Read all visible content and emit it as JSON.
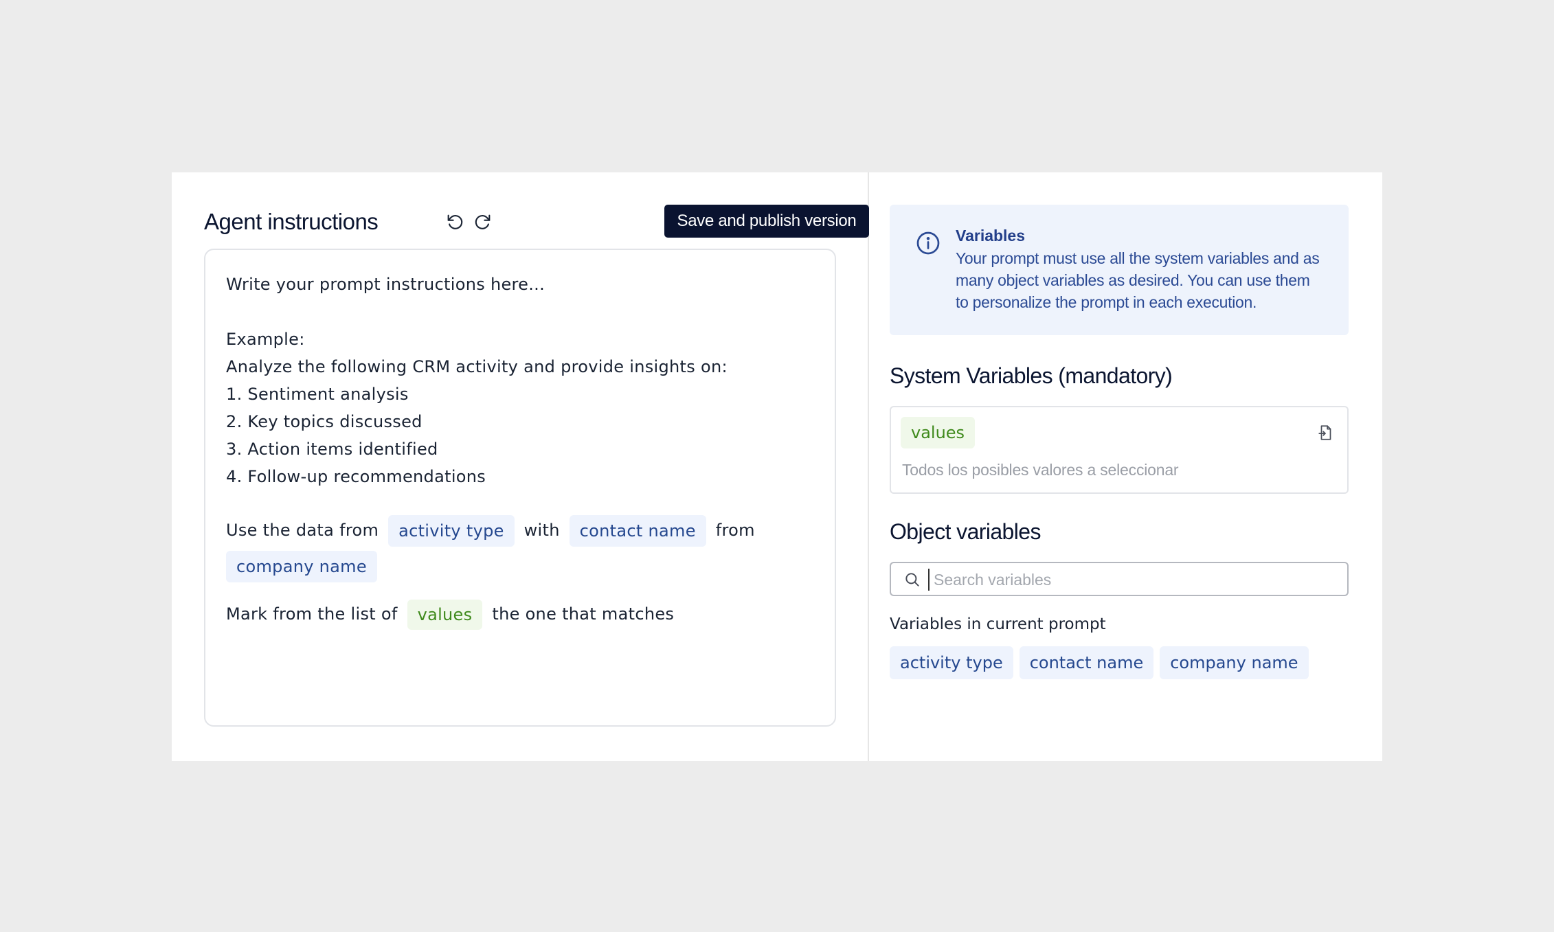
{
  "header": {
    "title": "Agent instructions",
    "undo_icon": "undo-icon",
    "redo_icon": "redo-icon",
    "publish_label": "Save and publish version"
  },
  "editor": {
    "lines": [
      "Write your prompt instructions here...",
      "Example:",
      "Analyze the following CRM activity and provide insights on:",
      "1. Sentiment analysis",
      "2. Key topics discussed",
      "3. Action items identified",
      "4. Follow-up recommendations"
    ],
    "sentence1": {
      "part1": "Use the data from",
      "var1": "activity type",
      "part2": "with",
      "var2": "contact name",
      "part3": "from",
      "var3": "company name"
    },
    "sentence2": {
      "part1": "Mark from the list of",
      "var1": "values",
      "part2": "the one that matches"
    }
  },
  "info": {
    "icon": "info-icon",
    "title": "Variables",
    "text": "Your prompt must use all the system variables and as many object variables as desired. You can use them to personalize the prompt in each execution."
  },
  "system_variables": {
    "title": "System Variables (mandatory)",
    "chip": "values",
    "description": "Todos los posibles valores a seleccionar",
    "action_icon": "document-insert-icon"
  },
  "object_variables": {
    "title": "Object variables",
    "search_placeholder": "Search variables",
    "search_value": "",
    "current_label": "Variables in current prompt",
    "current": [
      "activity type",
      "contact name",
      "company name"
    ]
  },
  "colors": {
    "primary_dark": "#0a1330",
    "chip_blue_bg": "#eef3fd",
    "chip_blue_text": "#25488f",
    "chip_green_bg": "#f0f8ea",
    "chip_green_text": "#3f8a1c",
    "info_bg": "#eef3fc"
  }
}
